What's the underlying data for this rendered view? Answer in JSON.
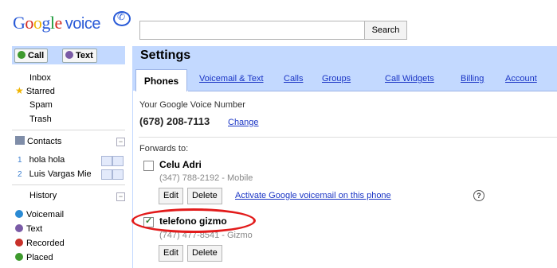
{
  "header": {
    "logo_text": "Google",
    "logo_sub": "voice",
    "search_button": "Search",
    "search_value": ""
  },
  "left": {
    "call_label": "Call",
    "text_label": "Text",
    "nav": [
      "Inbox",
      "Starred",
      "Spam",
      "Trash"
    ],
    "contacts_label": "Contacts",
    "contacts": [
      {
        "num": "1",
        "name": "hola hola"
      },
      {
        "num": "2",
        "name": "Luis Vargas Mie"
      }
    ],
    "history_label": "History",
    "history": [
      "Voicemail",
      "Text",
      "Recorded",
      "Placed"
    ],
    "colors": {
      "voicemail": "#2a8ad4",
      "text": "#7a5ba6",
      "recorded": "#c8312a",
      "placed": "#3e9a2e"
    }
  },
  "settings": {
    "title": "Settings",
    "tabs": [
      "Phones",
      "Voicemail & Text",
      "Calls",
      "Groups",
      "Call Widgets",
      "Billing",
      "Account"
    ],
    "active_tab": "Phones",
    "gv_number_label": "Your Google Voice Number",
    "gv_number": "(678) 208-7113",
    "change_link": "Change",
    "forwards_label": "Forwards to:",
    "phones": [
      {
        "name": "Celu Adri",
        "detail": "(347) 788-2192 - Mobile",
        "checked": false,
        "edit": "Edit",
        "delete": "Delete",
        "activate": "Activate Google voicemail on this phone"
      },
      {
        "name": "telefono gizmo",
        "detail": "(747) 477-8541 - Gizmo",
        "checked": true,
        "edit": "Edit",
        "delete": "Delete"
      }
    ]
  },
  "annotation_color": "#e21b1b"
}
